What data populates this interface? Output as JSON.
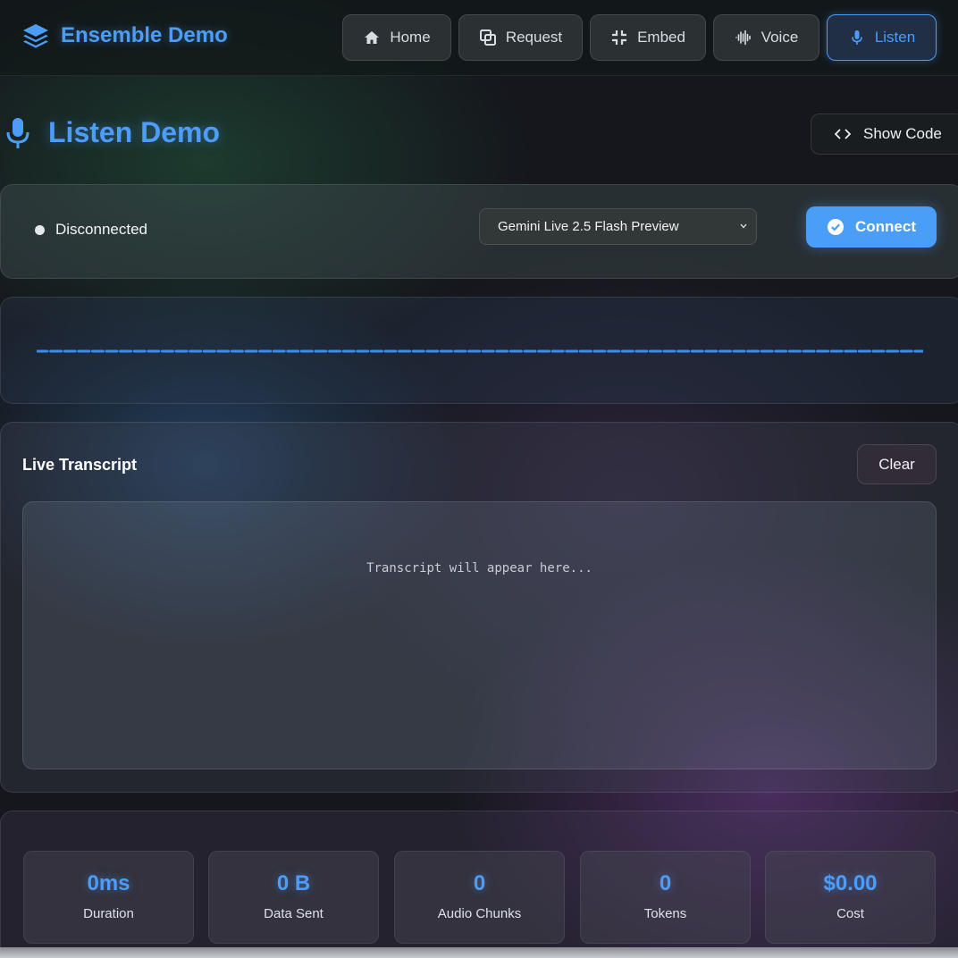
{
  "app": {
    "title": "Ensemble Demo"
  },
  "nav": {
    "items": [
      {
        "label": "Home",
        "icon": "home-icon",
        "active": false
      },
      {
        "label": "Request",
        "icon": "copy-icon",
        "active": false
      },
      {
        "label": "Embed",
        "icon": "compress-icon",
        "active": false
      },
      {
        "label": "Voice",
        "icon": "waveform-icon",
        "active": false
      },
      {
        "label": "Listen",
        "icon": "microphone-icon",
        "active": true
      }
    ]
  },
  "page": {
    "title": "Listen Demo",
    "show_code_label": "Show Code"
  },
  "connection": {
    "status": "Disconnected",
    "model_selected": "Gemini Live 2.5 Flash Preview",
    "connect_label": "Connect"
  },
  "transcript": {
    "title": "Live Transcript",
    "clear_label": "Clear",
    "placeholder": "Transcript will appear here..."
  },
  "stats": [
    {
      "value": "0ms",
      "label": "Duration"
    },
    {
      "value": "0 B",
      "label": "Data Sent"
    },
    {
      "value": "0",
      "label": "Audio Chunks"
    },
    {
      "value": "0",
      "label": "Tokens"
    },
    {
      "value": "$0.00",
      "label": "Cost"
    }
  ],
  "colors": {
    "accent": "#4d9cf7",
    "connect_bg": "#4b9ef8"
  }
}
